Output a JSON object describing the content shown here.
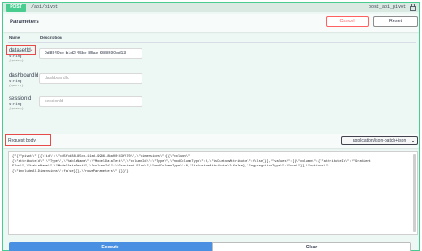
{
  "operation": {
    "method": "POST",
    "path": "/api/pivot",
    "operation_id": "post_api_pivot",
    "method_color": "#49cc90"
  },
  "parameters": {
    "title": "Parameters",
    "cancel_label": "Cancel",
    "reset_label": "Reset",
    "col_name": "Name",
    "col_description": "Description",
    "items": [
      {
        "name": "datasetId",
        "required": "*",
        "type": "string",
        "in": "(query)",
        "value": "0d8849ce-b1d2-45be-85ae-f988690dd13",
        "placeholder": ""
      },
      {
        "name": "dashboardId",
        "required": "",
        "type": "string",
        "in": "(query)",
        "value": "",
        "placeholder": "dashboardId"
      },
      {
        "name": "sessionId",
        "required": "",
        "type": "string",
        "in": "(query)",
        "value": "",
        "placeholder": "sessionId"
      }
    ]
  },
  "request_body": {
    "title": "Request body",
    "content_type": "application/json-patch+json",
    "lines": [
      "{\"{\\\"pivot\\\":[{\\\"id\\\":\\\"cd5fdd88-85cc-11ed-9986-8ba00f43f570\\\",\\\"dimensions\\\":[{\\\"column\\\":",
      "{\\\"attributeId\\\":\\\"Type\\\",\\\"tableName\\\":\\\"ModelDataTest\\\",\\\"columnId\\\":\\\"Type\\\",\\\"modColumnType\\\":0,\\\"isCustomAttribute\\\":false}}],\\\"values\\\":[{\\\"column\\\":{\\\"attributeId\\\":\\\"Gradient",
      "Flow\\\",\\\"tableName\\\":\\\"ModelDataTest\\\",\\\"columnId\\\":\\\"Gradient Flow\\\",\\\"modColumnType\\\":0,\\\"isCustomAttribute\\\":false},\\\"aggregationType\\\":\\\"sum\\\"}],\\\"options\\\":",
      "{\\\"includeAllDimensions\\\":false}}],\\\"rowsParameters\\\":{}}\"}"
    ]
  },
  "actions": {
    "execute_label": "Execute",
    "clear_label": "Clear"
  },
  "colors": {
    "accent": "#49cc90",
    "cancel": "#ff6060",
    "execute": "#4990e2",
    "highlight": "#e84a4a"
  }
}
